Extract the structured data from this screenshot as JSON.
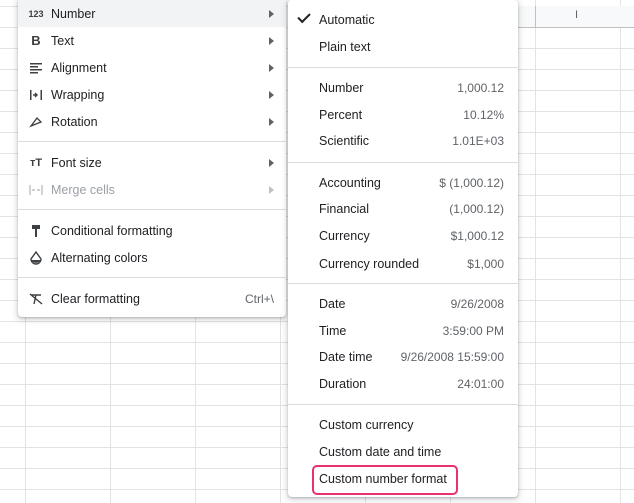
{
  "spreadsheet": {
    "column_header_letter": "I"
  },
  "format_menu": {
    "items": [
      {
        "label": "Number",
        "icon": "123-icon",
        "icon_text": "123",
        "has_submenu": true,
        "active": true
      },
      {
        "label": "Text",
        "icon": "bold-icon",
        "icon_text": "B",
        "has_submenu": true
      },
      {
        "label": "Alignment",
        "icon": "align-left-icon",
        "has_submenu": true
      },
      {
        "label": "Wrapping",
        "icon": "wrap-icon",
        "has_submenu": true
      },
      {
        "label": "Rotation",
        "icon": "rotation-icon",
        "has_submenu": true
      },
      {
        "label": "Font size",
        "icon": "font-size-icon",
        "icon_text": "тT",
        "has_submenu": true
      },
      {
        "label": "Merge cells",
        "icon": "merge-cells-icon",
        "has_submenu": true,
        "disabled": true
      },
      {
        "label": "Conditional formatting",
        "icon": "paint-roller-icon"
      },
      {
        "label": "Alternating colors",
        "icon": "fill-drop-icon"
      },
      {
        "label": "Clear formatting",
        "icon": "clear-format-icon",
        "shortcut": "Ctrl+\\"
      }
    ]
  },
  "number_submenu": {
    "items": [
      {
        "label": "Automatic",
        "checked": true
      },
      {
        "label": "Plain text"
      },
      {
        "label": "Number",
        "value": "1,000.12"
      },
      {
        "label": "Percent",
        "value": "10.12%"
      },
      {
        "label": "Scientific",
        "value": "1.01E+03"
      },
      {
        "label": "Accounting",
        "value": "$ (1,000.12)"
      },
      {
        "label": "Financial",
        "value": "(1,000.12)"
      },
      {
        "label": "Currency",
        "value": "$1,000.12"
      },
      {
        "label": "Currency rounded",
        "value": "$1,000"
      },
      {
        "label": "Date",
        "value": "9/26/2008"
      },
      {
        "label": "Time",
        "value": "3:59:00 PM"
      },
      {
        "label": "Date time",
        "value": "9/26/2008 15:59:00"
      },
      {
        "label": "Duration",
        "value": "24:01:00"
      },
      {
        "label": "Custom currency"
      },
      {
        "label": "Custom date and time"
      },
      {
        "label": "Custom number format",
        "highlighted": true
      }
    ]
  },
  "colors": {
    "highlight": "#e8336f",
    "active_row": "#f1f3f4"
  }
}
